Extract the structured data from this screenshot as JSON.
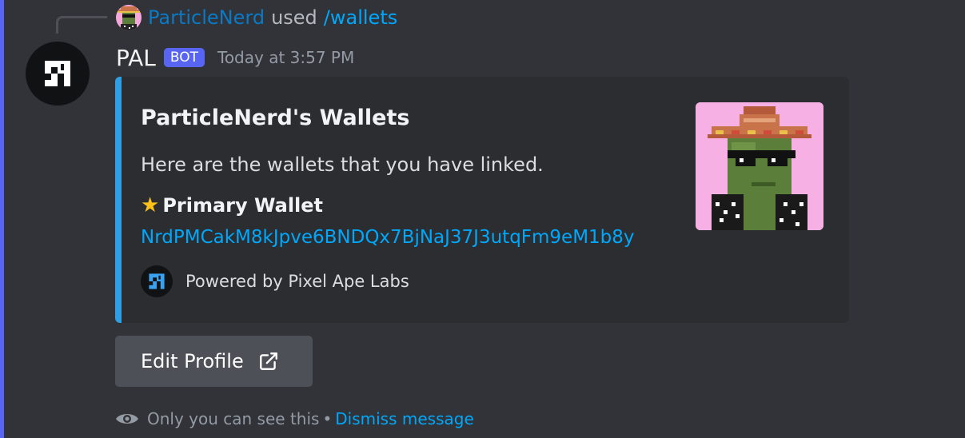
{
  "reply": {
    "username": "ParticleNerd",
    "used_text": "used",
    "command": "/wallets"
  },
  "message": {
    "author": "PAL",
    "bot_tag": "BOT",
    "timestamp": "Today at 3:57 PM"
  },
  "embed": {
    "accent_color": "#2f9ee3",
    "title": "ParticleNerd's Wallets",
    "description": "Here are the wallets that you have linked.",
    "field_icon": "star-icon",
    "field_name": "Primary Wallet",
    "field_value": "NrdPMCakM8kJpve6BNDQx7BjNaJ37J3utqFm9eM1b8y",
    "footer_text": "Powered by Pixel Ape Labs"
  },
  "button": {
    "label": "Edit Profile",
    "icon": "external-link-icon"
  },
  "ephemeral": {
    "text": "Only you can see this",
    "separator": "•",
    "dismiss": "Dismiss message"
  },
  "colors": {
    "background": "#313338",
    "blurple": "#5865f2",
    "link": "#00a8fc"
  }
}
